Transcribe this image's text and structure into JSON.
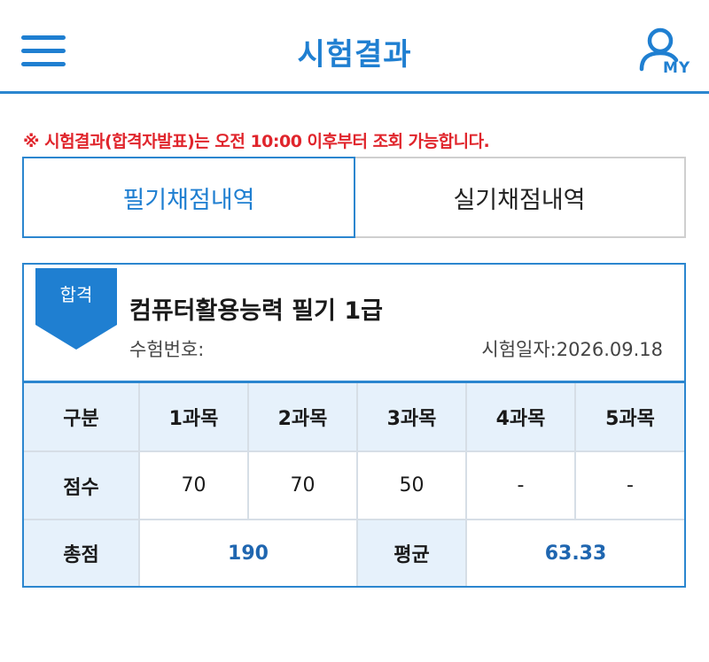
{
  "header": {
    "title": "시험결과",
    "my_label": "MY"
  },
  "notice": {
    "prefix": "※ 시험결과(합격자발표)는 오전 ",
    "time": "10:00",
    "suffix": " 이후부터 조회 가능합니다."
  },
  "tabs": [
    {
      "label": "필기채점내역",
      "active": true
    },
    {
      "label": "실기채점내역",
      "active": false
    }
  ],
  "result": {
    "badge": "합격",
    "exam_name": "컴퓨터활용능력 필기 1급",
    "exam_no_label": "수험번호:",
    "exam_date_label": "시험일자:",
    "exam_date": "2026.09.18"
  },
  "scores": {
    "row_headers": {
      "category": "구분",
      "score": "점수",
      "total": "총점",
      "average": "평균"
    },
    "subjects": [
      "1과목",
      "2과목",
      "3과목",
      "4과목",
      "5과목"
    ],
    "values": [
      "70",
      "70",
      "50",
      "-",
      "-"
    ],
    "total": "190",
    "average": "63.33"
  },
  "colors": {
    "accent": "#1f7fd1",
    "notice": "#e0252c",
    "header_cell": "#e6f1fb",
    "emphasis": "#1f66b0"
  }
}
